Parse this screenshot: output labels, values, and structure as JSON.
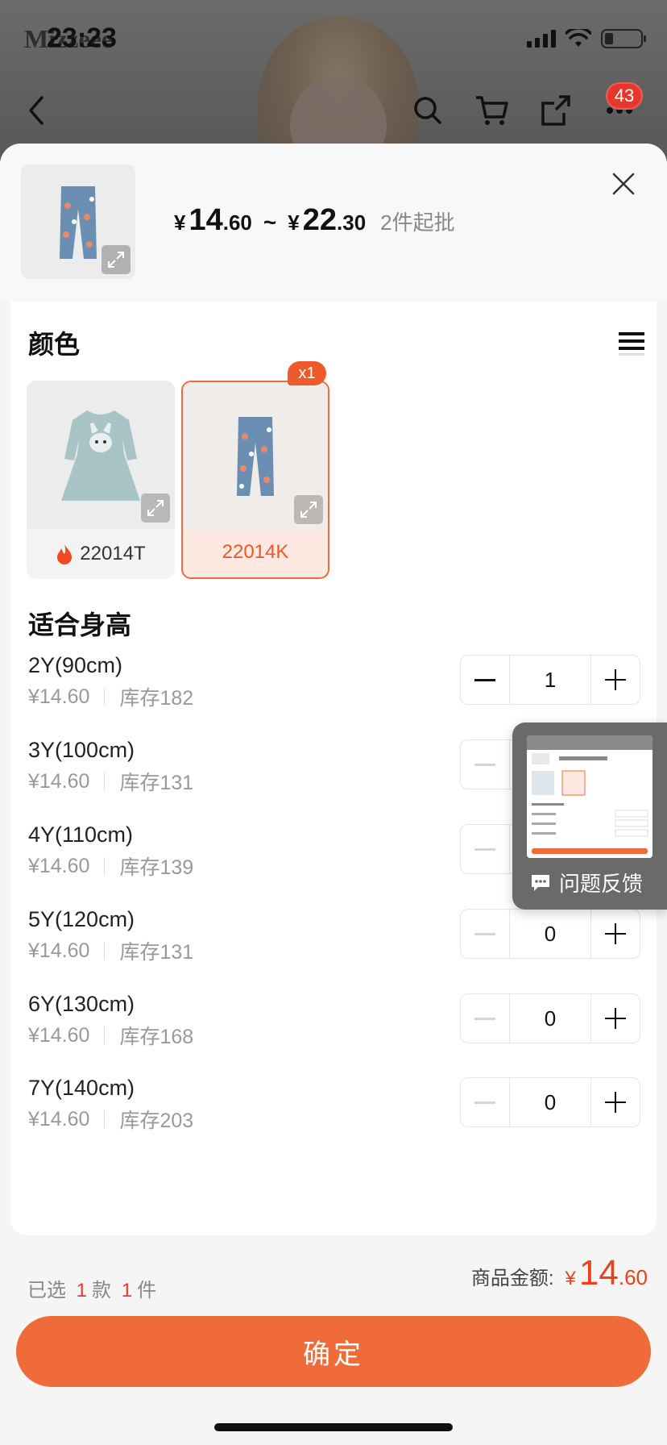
{
  "status_bar": {
    "time": "23:23",
    "brand": "Mizzeee"
  },
  "nav": {
    "cart_badge": "43"
  },
  "sheet": {
    "price": {
      "min_currency": "¥",
      "min_int": "14",
      "min_dec": ".60",
      "separator": "~",
      "max_currency": "¥",
      "max_int": "22",
      "max_dec": ".30",
      "moq": "2件起批"
    },
    "color_section": {
      "title": "颜色",
      "options": [
        {
          "label": "22014T",
          "selected": false,
          "hot": true
        },
        {
          "label": "22014K",
          "selected": true,
          "hot": false,
          "badge": "x1"
        }
      ]
    },
    "size_section": {
      "title": "适合身高",
      "rows": [
        {
          "name": "2Y(90cm)",
          "price": "¥14.60",
          "stock": "库存182",
          "qty": "1"
        },
        {
          "name": "3Y(100cm)",
          "price": "¥14.60",
          "stock": "库存131",
          "qty": "0"
        },
        {
          "name": "4Y(110cm)",
          "price": "¥14.60",
          "stock": "库存139",
          "qty": "0"
        },
        {
          "name": "5Y(120cm)",
          "price": "¥14.60",
          "stock": "库存131",
          "qty": "0"
        },
        {
          "name": "6Y(130cm)",
          "price": "¥14.60",
          "stock": "库存168",
          "qty": "0"
        },
        {
          "name": "7Y(140cm)",
          "price": "¥14.60",
          "stock": "库存203",
          "qty": "0"
        }
      ]
    }
  },
  "feedback": {
    "label": "问题反馈"
  },
  "footer": {
    "selected_prefix": "已选",
    "styles_count": "1",
    "styles_unit": "款",
    "items_count": "1",
    "items_unit": "件",
    "total_label": "商品金额:",
    "total_currency": "¥",
    "total_int": "14",
    "total_dec": ".60",
    "confirm_label": "确定"
  },
  "colors": {
    "accent": "#ef6b3a",
    "price_red": "#e8431c"
  }
}
